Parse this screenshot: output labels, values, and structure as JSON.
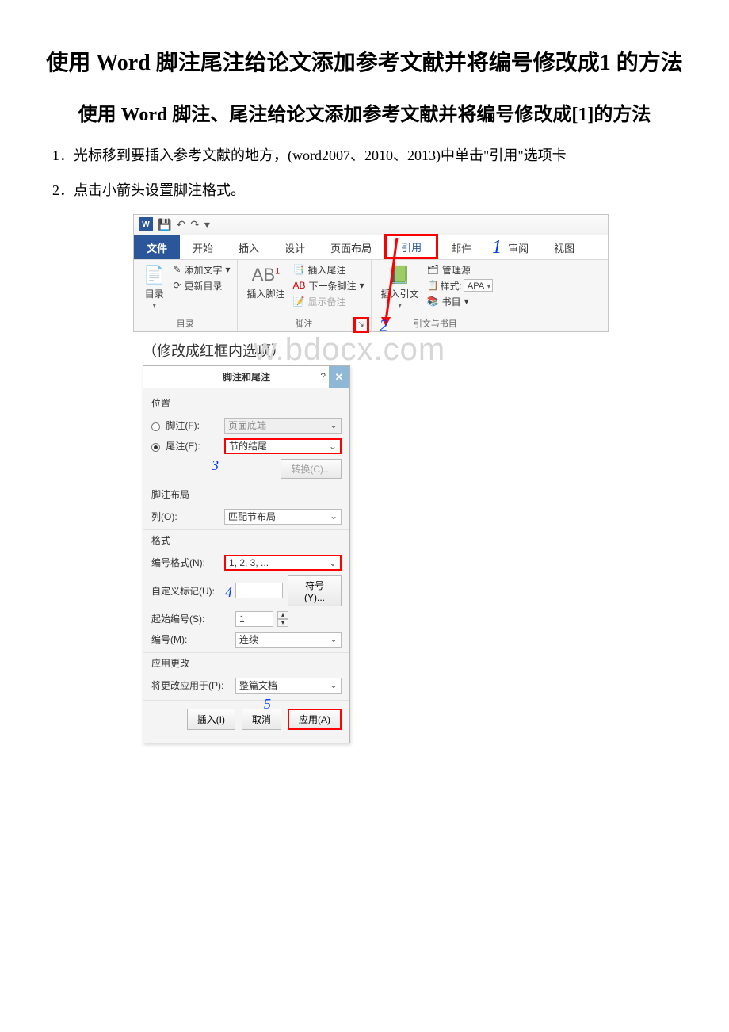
{
  "title_main": "使用 Word 脚注尾注给论文添加参考文献并将编号修改成1 的方法",
  "title_sub": "使用 Word 脚注、尾注给论文添加参考文献并将编号修改成[1]的方法",
  "para1": "1．光标移到要插入参考文献的地方，(word2007、2010、2013)中单击\"引用\"选项卡",
  "para2": "2．点击小箭头设置脚注格式。",
  "ribbon": {
    "qat_save": "💾",
    "qat_undo": "↶",
    "qat_redo": "↷",
    "tab_file": "文件",
    "tab_home": "开始",
    "tab_insert": "插入",
    "tab_design": "设计",
    "tab_layout": "页面布局",
    "tab_ref": "引用",
    "tab_mail": "邮件",
    "tab_review": "审阅",
    "tab_view": "视图",
    "annot1": "1",
    "grp_toc": {
      "label": "目录",
      "btn_toc": "目录",
      "add_text": "添加文字",
      "update": "更新目录"
    },
    "grp_fn": {
      "label": "脚注",
      "insert_fn": "插入脚注",
      "ab": "AB",
      "insert_en": "插入尾注",
      "next_fn": "下一条脚注",
      "show_notes": "显示备注",
      "annot2": "2"
    },
    "grp_cite": {
      "label": "引文与书目",
      "insert_cite": "插入引文",
      "manage": "管理源",
      "style_lbl": "样式:",
      "style_val": "APA",
      "biblio": "书目"
    }
  },
  "caption": "（修改成红框内选项）",
  "watermark": "w.bdocx.com",
  "dlg": {
    "title": "脚注和尾注",
    "sect_pos": "位置",
    "fn_label": "脚注(F):",
    "fn_val": "页面底端",
    "en_label": "尾注(E):",
    "en_val": "节的结尾",
    "convert_btn": "转换(C)...",
    "annot3": "3",
    "sect_layout": "脚注布局",
    "col_label": "列(O):",
    "col_val": "匹配节布局",
    "sect_fmt": "格式",
    "numfmt_label": "编号格式(N):",
    "numfmt_val": "1, 2, 3, ...",
    "custom_label": "自定义标记(U):",
    "symbol_btn": "符号(Y)...",
    "annot4": "4",
    "start_label": "起始编号(S):",
    "start_val": "1",
    "numbering_label": "编号(M):",
    "numbering_val": "连续",
    "sect_apply": "应用更改",
    "applyto_label": "将更改应用于(P):",
    "applyto_val": "整篇文档",
    "insert_btn": "插入(I)",
    "cancel_btn": "取消",
    "apply_btn": "应用(A)",
    "annot5": "5"
  }
}
